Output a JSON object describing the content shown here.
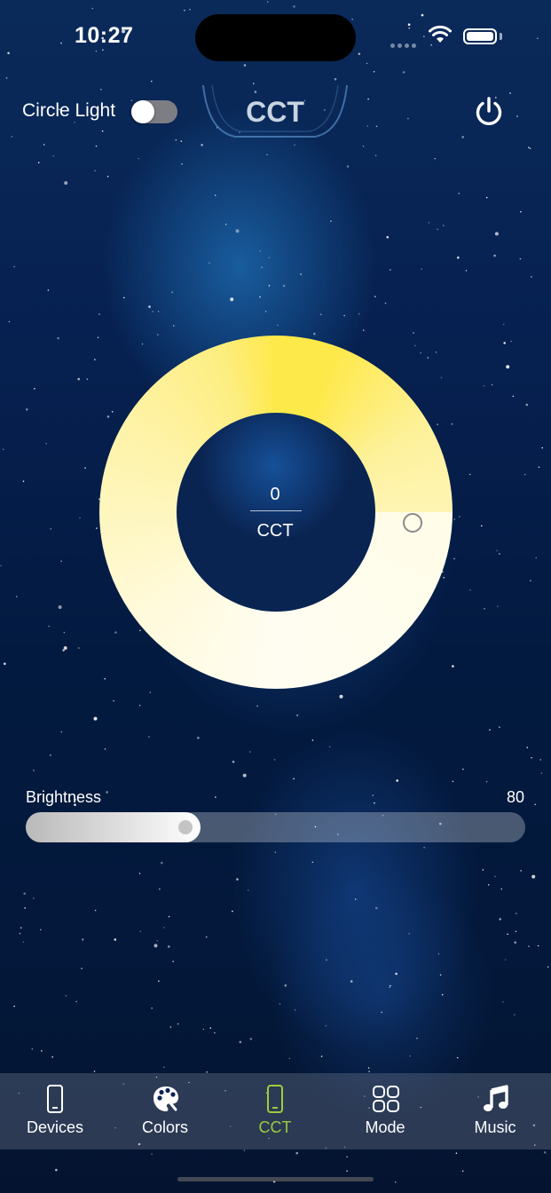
{
  "status_bar": {
    "time": "10:27"
  },
  "header": {
    "circle_light_label": "Circle Light",
    "circle_light_on": false,
    "title": "CCT"
  },
  "icons": {
    "power": "power-icon",
    "wifi": "wifi-icon",
    "battery": "battery-icon"
  },
  "wheel": {
    "value": "0",
    "label": "CCT",
    "warm_color": "#fee94a",
    "cool_color": "#fffdf2"
  },
  "brightness": {
    "label": "Brightness",
    "value": "80",
    "level": 0.35
  },
  "tabs": [
    {
      "label": "Devices",
      "icon": "phone-icon",
      "active": false
    },
    {
      "label": "Colors",
      "icon": "palette-icon",
      "active": false
    },
    {
      "label": "CCT",
      "icon": "phone-icon",
      "active": true
    },
    {
      "label": "Mode",
      "icon": "grid-icon",
      "active": false
    },
    {
      "label": "Music",
      "icon": "music-note-icon",
      "active": false
    }
  ],
  "colors": {
    "accent": "#9ccc3c"
  }
}
